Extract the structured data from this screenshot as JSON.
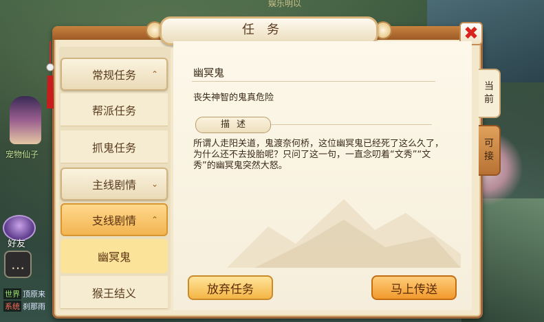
{
  "background": {
    "top_text": "娱乐明以",
    "pet_label": "宠物仙子",
    "friend_label": "好友",
    "chat": [
      {
        "channel": "世界",
        "text": "顶原来"
      },
      {
        "channel": "系统",
        "text": "刹那雨"
      }
    ]
  },
  "window": {
    "title": "任务",
    "close_label": "✖"
  },
  "sidebar": {
    "categories": [
      {
        "label": "常规任务",
        "chevron": "⌃"
      },
      {
        "label": "帮派任务"
      },
      {
        "label": "抓鬼任务"
      },
      {
        "label": "主线剧情",
        "chevron": "⌄"
      },
      {
        "label": "支线剧情",
        "chevron": "⌃"
      },
      {
        "label": "幽冥鬼"
      },
      {
        "label": "猴王结义"
      }
    ]
  },
  "task": {
    "name": "幽冥鬼",
    "subtitle": "丧失神智的鬼真危险",
    "desc_tag": "描述",
    "description": "所谓人走阳关道，鬼渡奈何桥，这位幽冥鬼已经死了这么久了，为什么还不去投胎呢？只问了这一句，一直念叨着“文秀”“文秀”的幽冥鬼突然大怒。"
  },
  "buttons": {
    "abandon": "放弃任务",
    "teleport": "马上传送"
  },
  "tabs": {
    "current": [
      "当",
      "前"
    ],
    "available": [
      "可",
      "接"
    ]
  },
  "colors": {
    "panel": "#f3e8cc",
    "frame": "#a36a3e",
    "active": "#f2b451",
    "close": "#d8241c"
  }
}
